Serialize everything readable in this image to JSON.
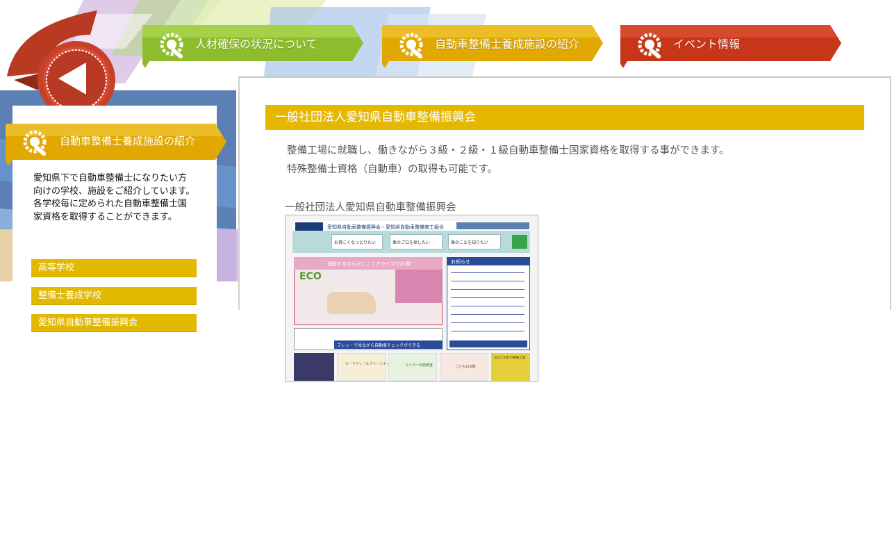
{
  "colors": {
    "green_tab": "#8dbd2c",
    "yellow_tab": "#e0a800",
    "red_tab": "#c8361a",
    "section_bar": "#e4b800",
    "side_link": "#e2b800"
  },
  "nav": {
    "back_icon": "back-arrow-icon",
    "tabs": [
      {
        "label": "人材確保の状況について",
        "icon": "wrench-gear-icon",
        "color": "green"
      },
      {
        "label": "自動車整備士養成施設の紹介",
        "icon": "wrench-gear-icon",
        "color": "yellow"
      },
      {
        "label": "イベント情報",
        "icon": "wrench-gear-icon",
        "color": "red"
      }
    ]
  },
  "sidebar": {
    "heading": "自動車整備士養成施設の紹介",
    "heading_icon": "wrench-gear-icon",
    "description": "愛知県下で自動車整備士になりたい方\n向けの学校、施設をご紹介しています。\n各学校毎に定められた自動車整備士国\n家資格を取得することができます。",
    "links": [
      {
        "label": "高等学校"
      },
      {
        "label": "整備士養成学校"
      },
      {
        "label": "愛知県自動車整備振興会"
      }
    ]
  },
  "main": {
    "section_title": "一般社団法人愛知県自動車整備振興会",
    "body_lines": [
      "整備工場に就職し、働きながら３級・２級・１級自動車整備士国家資格を取得する事ができます。",
      "特殊整備士資格（自動車）の取得も可能です。"
    ],
    "site_caption": "一般社団法人愛知県自動車整備振興会",
    "site_thumbnail": {
      "header_title": "愛知県自動車整備振興会・愛知県自動車整備商工組合",
      "nav_buttons": [
        "お得こくなっとりたい",
        "車のプロを探したい",
        "車のことを知りたい"
      ],
      "banner_text": "運転するならかしこくドライブでお得！",
      "eco_label": "ECO",
      "news_heading": "お知らせ",
      "banner2_text": "ブレッ・で見ながら自動車チェックができる",
      "bottom_tiles": [
        "セーフティー＆クリーンキャンペーン",
        "マイカー点検教室",
        "こども110番",
        "あなたの町の整備工場"
      ]
    }
  }
}
